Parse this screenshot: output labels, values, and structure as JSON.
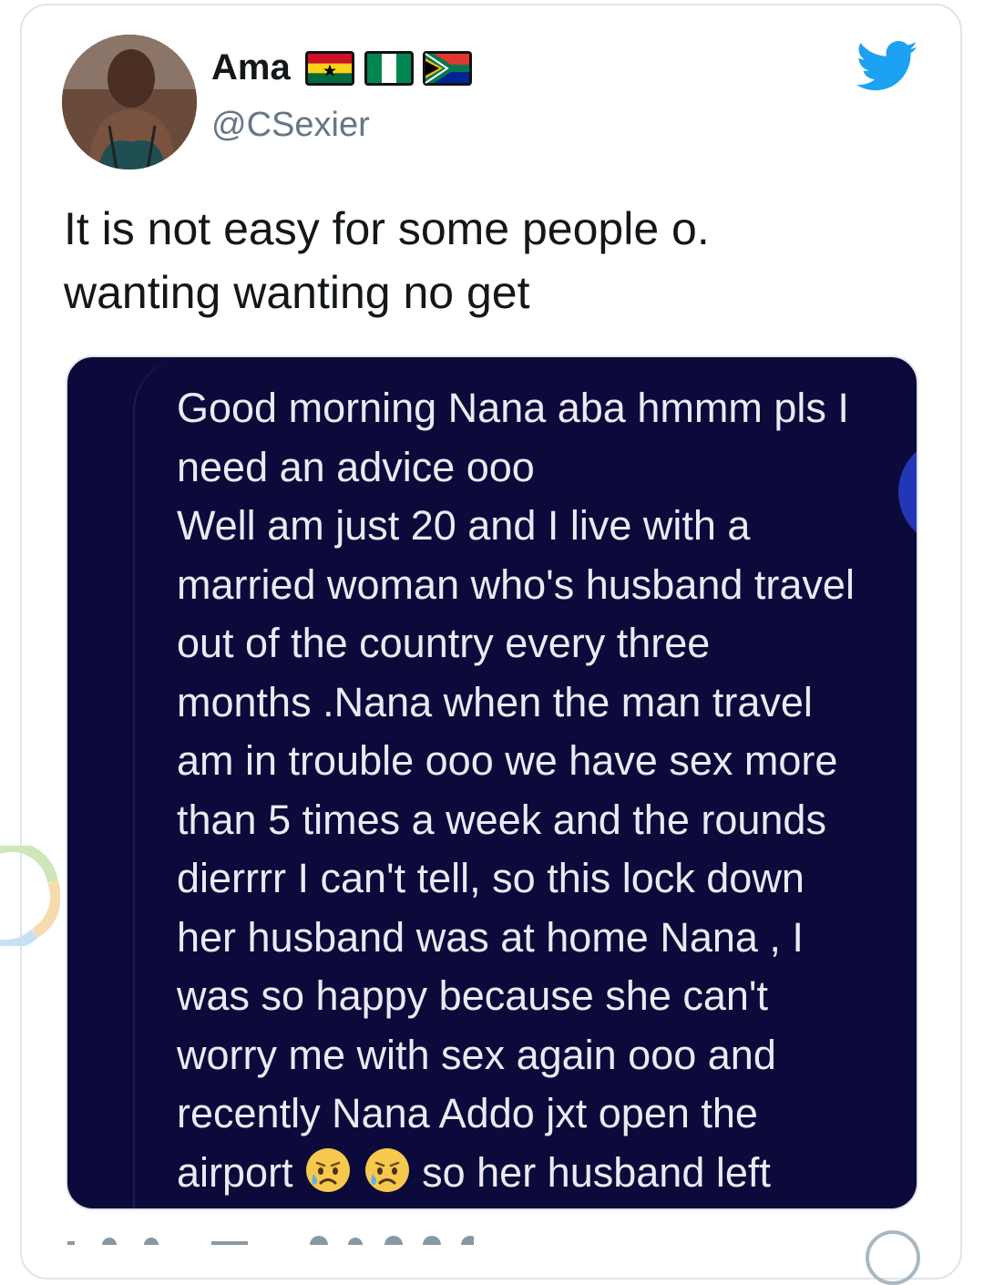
{
  "author": {
    "display_name": "Ama",
    "handle": "@CSexier",
    "flags": [
      "ghana-flag-icon",
      "nigeria-flag-icon",
      "south-africa-flag-icon"
    ]
  },
  "tweet": {
    "lines": [
      "It is not easy for some people o.",
      "wanting wanting no get"
    ]
  },
  "media": {
    "lines": [
      "Good morning Nana aba hmmm pls I",
      "need an advice ooo",
      "Well am just 20 and I live with a",
      "married woman who's husband travel",
      "out of the country every three",
      "months .Nana when the man travel",
      "am in trouble ooo we have sex more",
      "than 5 times a week and the rounds",
      "dierrrr I can't tell, so this lock down",
      "her husband was at home Nana , I",
      "was so happy because she can't",
      "worry me with sex again ooo and",
      "recently Nana Addo jxt open the"
    ],
    "last_line_start": "airport",
    "last_line_end": "so her husband left",
    "emojis": [
      "sad-relieved-face-icon",
      "sad-relieved-face-icon"
    ]
  },
  "colors": {
    "brand": "#1da1f2",
    "media_bg": "#0b0a3b",
    "handle": "#657786"
  },
  "icons": [
    "twitter-bird-icon",
    "loading-spinner-icon"
  ]
}
